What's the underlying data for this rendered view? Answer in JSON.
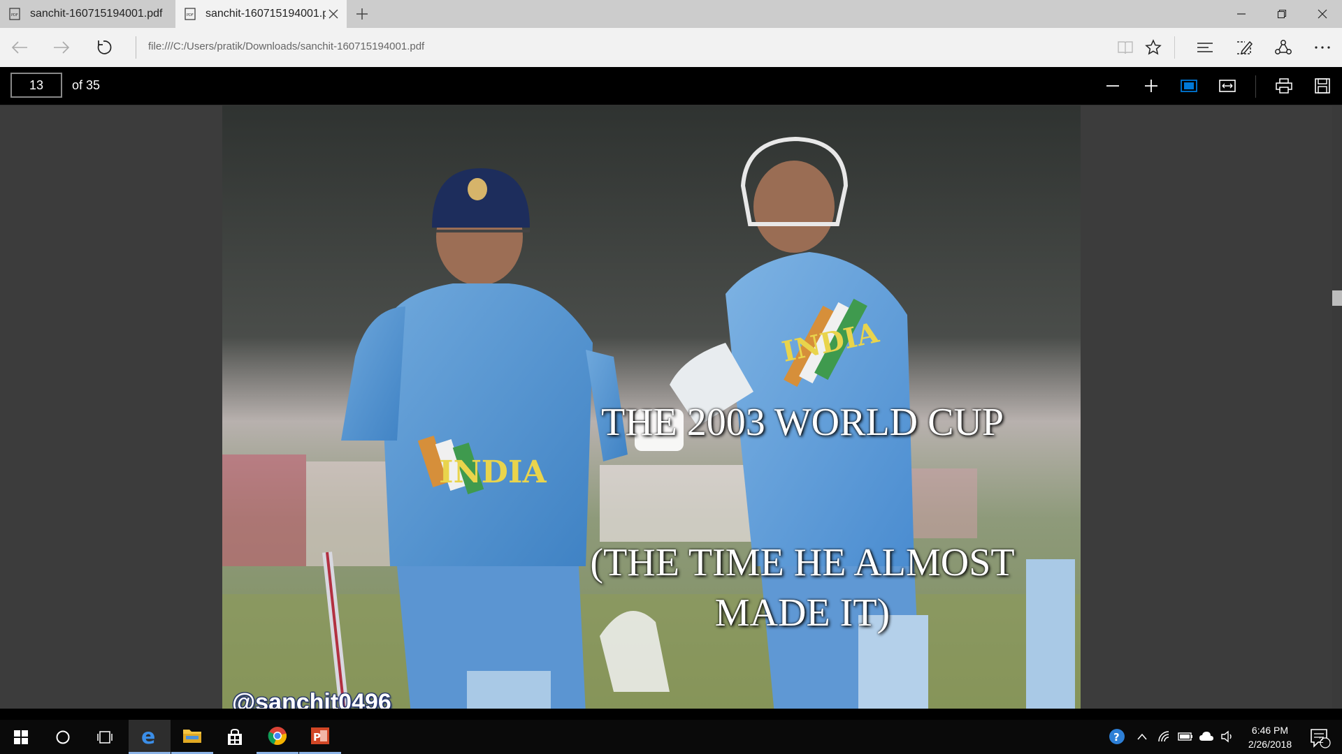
{
  "browser": {
    "tabs": [
      {
        "title": "sanchit-160715194001.pdf",
        "active": false
      },
      {
        "title": "sanchit-160715194001.pdf",
        "active": true
      }
    ],
    "address": "file:///C:/Users/pratik/Downloads/sanchit-160715194001.pdf"
  },
  "pdf_toolbar": {
    "current_page": "13",
    "page_count": "of 35"
  },
  "slide": {
    "title": "THE 2003 WORLD CUP",
    "subtitle_line1": "(THE TIME HE ALMOST",
    "subtitle_line2": "MADE IT)",
    "watermark": "@sanchit0496",
    "jersey_text_left": "INDIA",
    "jersey_text_right": "INDIA"
  },
  "taskbar": {
    "apps": [
      "start",
      "cortana",
      "task-view",
      "edge",
      "file-explorer",
      "store",
      "chrome",
      "powerpoint"
    ],
    "clock_time": "6:46 PM",
    "clock_date": "2/26/2018",
    "notification_count": "2"
  },
  "colors": {
    "tabstrip": "#cccccc",
    "active_tab": "#f2f2f2",
    "pdf_toolbar": "#000000",
    "viewer_bg": "#3c3c3c",
    "taskbar": "#0a0a0a",
    "accent": "#0078d7"
  }
}
